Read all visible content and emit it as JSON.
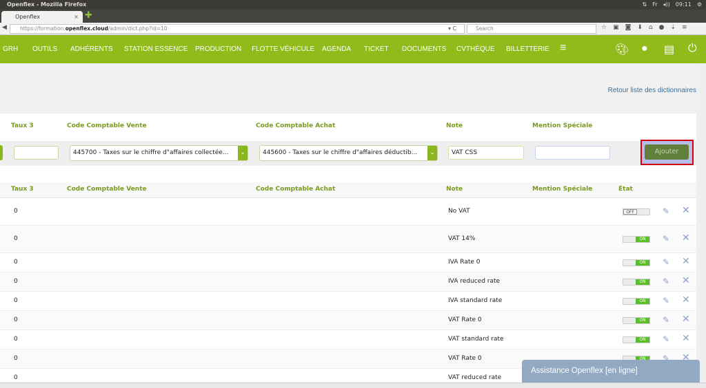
{
  "window": {
    "title": "Openflex - Mozilla Firefox",
    "tray": [
      "⇅",
      "Fr",
      "◂))",
      "09:11",
      "⚙"
    ]
  },
  "browser": {
    "tab_label": "Openflex",
    "tab_close": "×",
    "new_tab": "✚",
    "url_prefix": "https://formation.",
    "url_domain": "openflex.cloud",
    "url_path": "/admin/dict.php?id=10",
    "reload": "▾ C",
    "search_placeholder": "Search",
    "toolbar_icons": [
      "☆",
      "▣",
      "◙",
      "⬇",
      "⌂",
      "●",
      "⇣",
      "≡"
    ]
  },
  "nav": {
    "items": [
      "GRH",
      "OUTILS",
      "ADHÉRENTS",
      "STATION ESSENCE",
      "PRODUCTION",
      "FLOTTE VÉHICULE",
      "AGENDA",
      "TICKET",
      "DOCUMENTS",
      "CVTHÈQUE",
      "BILLETTERIE"
    ],
    "menu_icon": "≡",
    "icons": [
      "palette-icon",
      "user-icon",
      "print-icon",
      "power-icon"
    ],
    "accent": "#90bb1b"
  },
  "back_link": "Retour liste des dictionnaires",
  "form": {
    "headers": {
      "taux3": "Taux 3",
      "ccv": "Code Comptable Vente",
      "cca": "Code Comptable Achat",
      "note": "Note",
      "mention": "Mention Spéciale"
    },
    "taux3_value": "",
    "ccv_value": "445700 - Taxes sur le chiffre d\"affaires collectée...",
    "cca_value": "445600 - Taxes sur le chiffre d\"affaires déductib...",
    "note_value": "VAT CSS",
    "mention_value": "",
    "submit": "Ajouter"
  },
  "table": {
    "headers": {
      "taux3": "Taux 3",
      "ccv": "Code Comptable Vente",
      "cca": "Code Comptable Achat",
      "note": "Note",
      "mention": "Mention Spéciale",
      "etat": "État"
    },
    "rows": [
      {
        "taux3": "0",
        "note": "No VAT",
        "state": "OFF"
      },
      {
        "taux3": "0",
        "note": "VAT 14%",
        "state": "ON"
      },
      {
        "taux3": "0",
        "note": "IVA Rate 0",
        "state": "ON"
      },
      {
        "taux3": "0",
        "note": "IVA reduced rate",
        "state": "ON"
      },
      {
        "taux3": "0",
        "note": "IVA standard rate",
        "state": "ON"
      },
      {
        "taux3": "0",
        "note": "VAT Rate 0",
        "state": "ON"
      },
      {
        "taux3": "0",
        "note": "VAT standard rate",
        "state": "ON"
      },
      {
        "taux3": "0",
        "note": "VAT Rate 0",
        "state": "ON"
      },
      {
        "taux3": "0",
        "note": "VAT reduced rate",
        "state": "ON"
      }
    ]
  },
  "assist": "Assistance Openflex [en ligne]"
}
